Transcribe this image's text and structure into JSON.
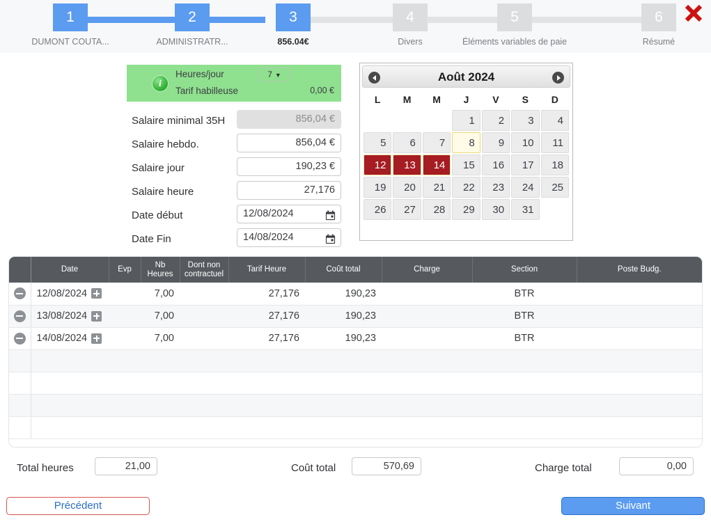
{
  "stepper": {
    "steps": [
      {
        "num": "1",
        "caption": "DUMONT COUTA...",
        "state": "done"
      },
      {
        "num": "2",
        "caption": "ADMINISTRATR...",
        "state": "done"
      },
      {
        "num": "3",
        "caption": "856.04€",
        "state": "current"
      },
      {
        "num": "4",
        "caption": "Divers",
        "state": "todo"
      },
      {
        "num": "5",
        "caption": "Éléments variables de paie",
        "state": "todo"
      },
      {
        "num": "6",
        "caption": "Résumé",
        "state": "todo"
      }
    ],
    "close_icon": "close-x-icon",
    "accent_active": "#5b9bf0",
    "accent_inactive": "#dcdddf",
    "close_color": "#cc1111"
  },
  "form": {
    "green_panel": {
      "bg": "#8fe08f",
      "info_icon": "info-icon",
      "hours_per_day_label": "Heures/jour",
      "hours_per_day_value": "7",
      "tarif_label": "Tarif habilleuse",
      "tarif_value": "0,00 €"
    },
    "fields": [
      {
        "label": "Salaire minimal 35H",
        "value": "856,04 €",
        "type": "number",
        "disabled": true
      },
      {
        "label": "Salaire hebdo.",
        "value": "856,04 €",
        "type": "number",
        "disabled": false
      },
      {
        "label": "Salaire jour",
        "value": "190,23 €",
        "type": "number",
        "disabled": false
      },
      {
        "label": "Salaire heure",
        "value": "27,176",
        "type": "number",
        "disabled": false
      },
      {
        "label": "Date début",
        "value": "12/08/2024",
        "type": "date",
        "disabled": false
      },
      {
        "label": "Date Fin",
        "value": "14/08/2024",
        "type": "date",
        "disabled": false
      }
    ]
  },
  "calendar": {
    "title": "Août 2024",
    "prev_icon": "chevron-left-icon",
    "next_icon": "chevron-right-icon",
    "weekdays": [
      "L",
      "M",
      "M",
      "J",
      "V",
      "S",
      "D"
    ],
    "weeks": [
      [
        {
          "d": ""
        },
        {
          "d": ""
        },
        {
          "d": ""
        },
        {
          "d": "1"
        },
        {
          "d": "2"
        },
        {
          "d": "3"
        },
        {
          "d": "4"
        }
      ],
      [
        {
          "d": "5"
        },
        {
          "d": "6"
        },
        {
          "d": "7"
        },
        {
          "d": "8",
          "state": "today"
        },
        {
          "d": "9"
        },
        {
          "d": "10"
        },
        {
          "d": "11"
        }
      ],
      [
        {
          "d": "12",
          "state": "sel"
        },
        {
          "d": "13",
          "state": "sel"
        },
        {
          "d": "14",
          "state": "sel"
        },
        {
          "d": "15"
        },
        {
          "d": "16"
        },
        {
          "d": "17"
        },
        {
          "d": "18"
        }
      ],
      [
        {
          "d": "19"
        },
        {
          "d": "20"
        },
        {
          "d": "21"
        },
        {
          "d": "22"
        },
        {
          "d": "23"
        },
        {
          "d": "24"
        },
        {
          "d": "25"
        }
      ],
      [
        {
          "d": "26"
        },
        {
          "d": "27"
        },
        {
          "d": "28"
        },
        {
          "d": "29"
        },
        {
          "d": "30"
        },
        {
          "d": "31"
        },
        {
          "d": ""
        }
      ]
    ],
    "selected_color": "#a51c22"
  },
  "table": {
    "headers": [
      "",
      "Date",
      "Evp",
      "Nb\nHeures",
      "Dont non\ncontractuel",
      "Tarif Heure",
      "Coût total",
      "Charge",
      "Section",
      "Poste Budg."
    ],
    "header_bg": "#565a5e",
    "rows": [
      {
        "date": "12/08/2024",
        "evp": "",
        "nb_heures": "7,00",
        "dont_non_contractuel": "",
        "tarif_heure": "27,176",
        "cout_total": "190,23",
        "charge": "",
        "section": "BTR",
        "poste_budg": ""
      },
      {
        "date": "13/08/2024",
        "evp": "",
        "nb_heures": "7,00",
        "dont_non_contractuel": "",
        "tarif_heure": "27,176",
        "cout_total": "190,23",
        "charge": "",
        "section": "BTR",
        "poste_budg": ""
      },
      {
        "date": "14/08/2024",
        "evp": "",
        "nb_heures": "7,00",
        "dont_non_contractuel": "",
        "tarif_heure": "27,176",
        "cout_total": "190,23",
        "charge": "",
        "section": "BTR",
        "poste_budg": ""
      }
    ],
    "empty_rows": 4,
    "row_remove_icon": "minus-circle-icon",
    "row_expand_icon": "plus-square-icon"
  },
  "totals": [
    {
      "label": "Total heures",
      "value": "21,00"
    },
    {
      "label": "Coût total",
      "value": "570,69"
    },
    {
      "label": "Charge total",
      "value": "0,00"
    }
  ],
  "footer": {
    "prev_label": "Précédent",
    "next_label": "Suivant",
    "prev_border": "#d9534f",
    "next_bg": "#5b9bf0"
  }
}
